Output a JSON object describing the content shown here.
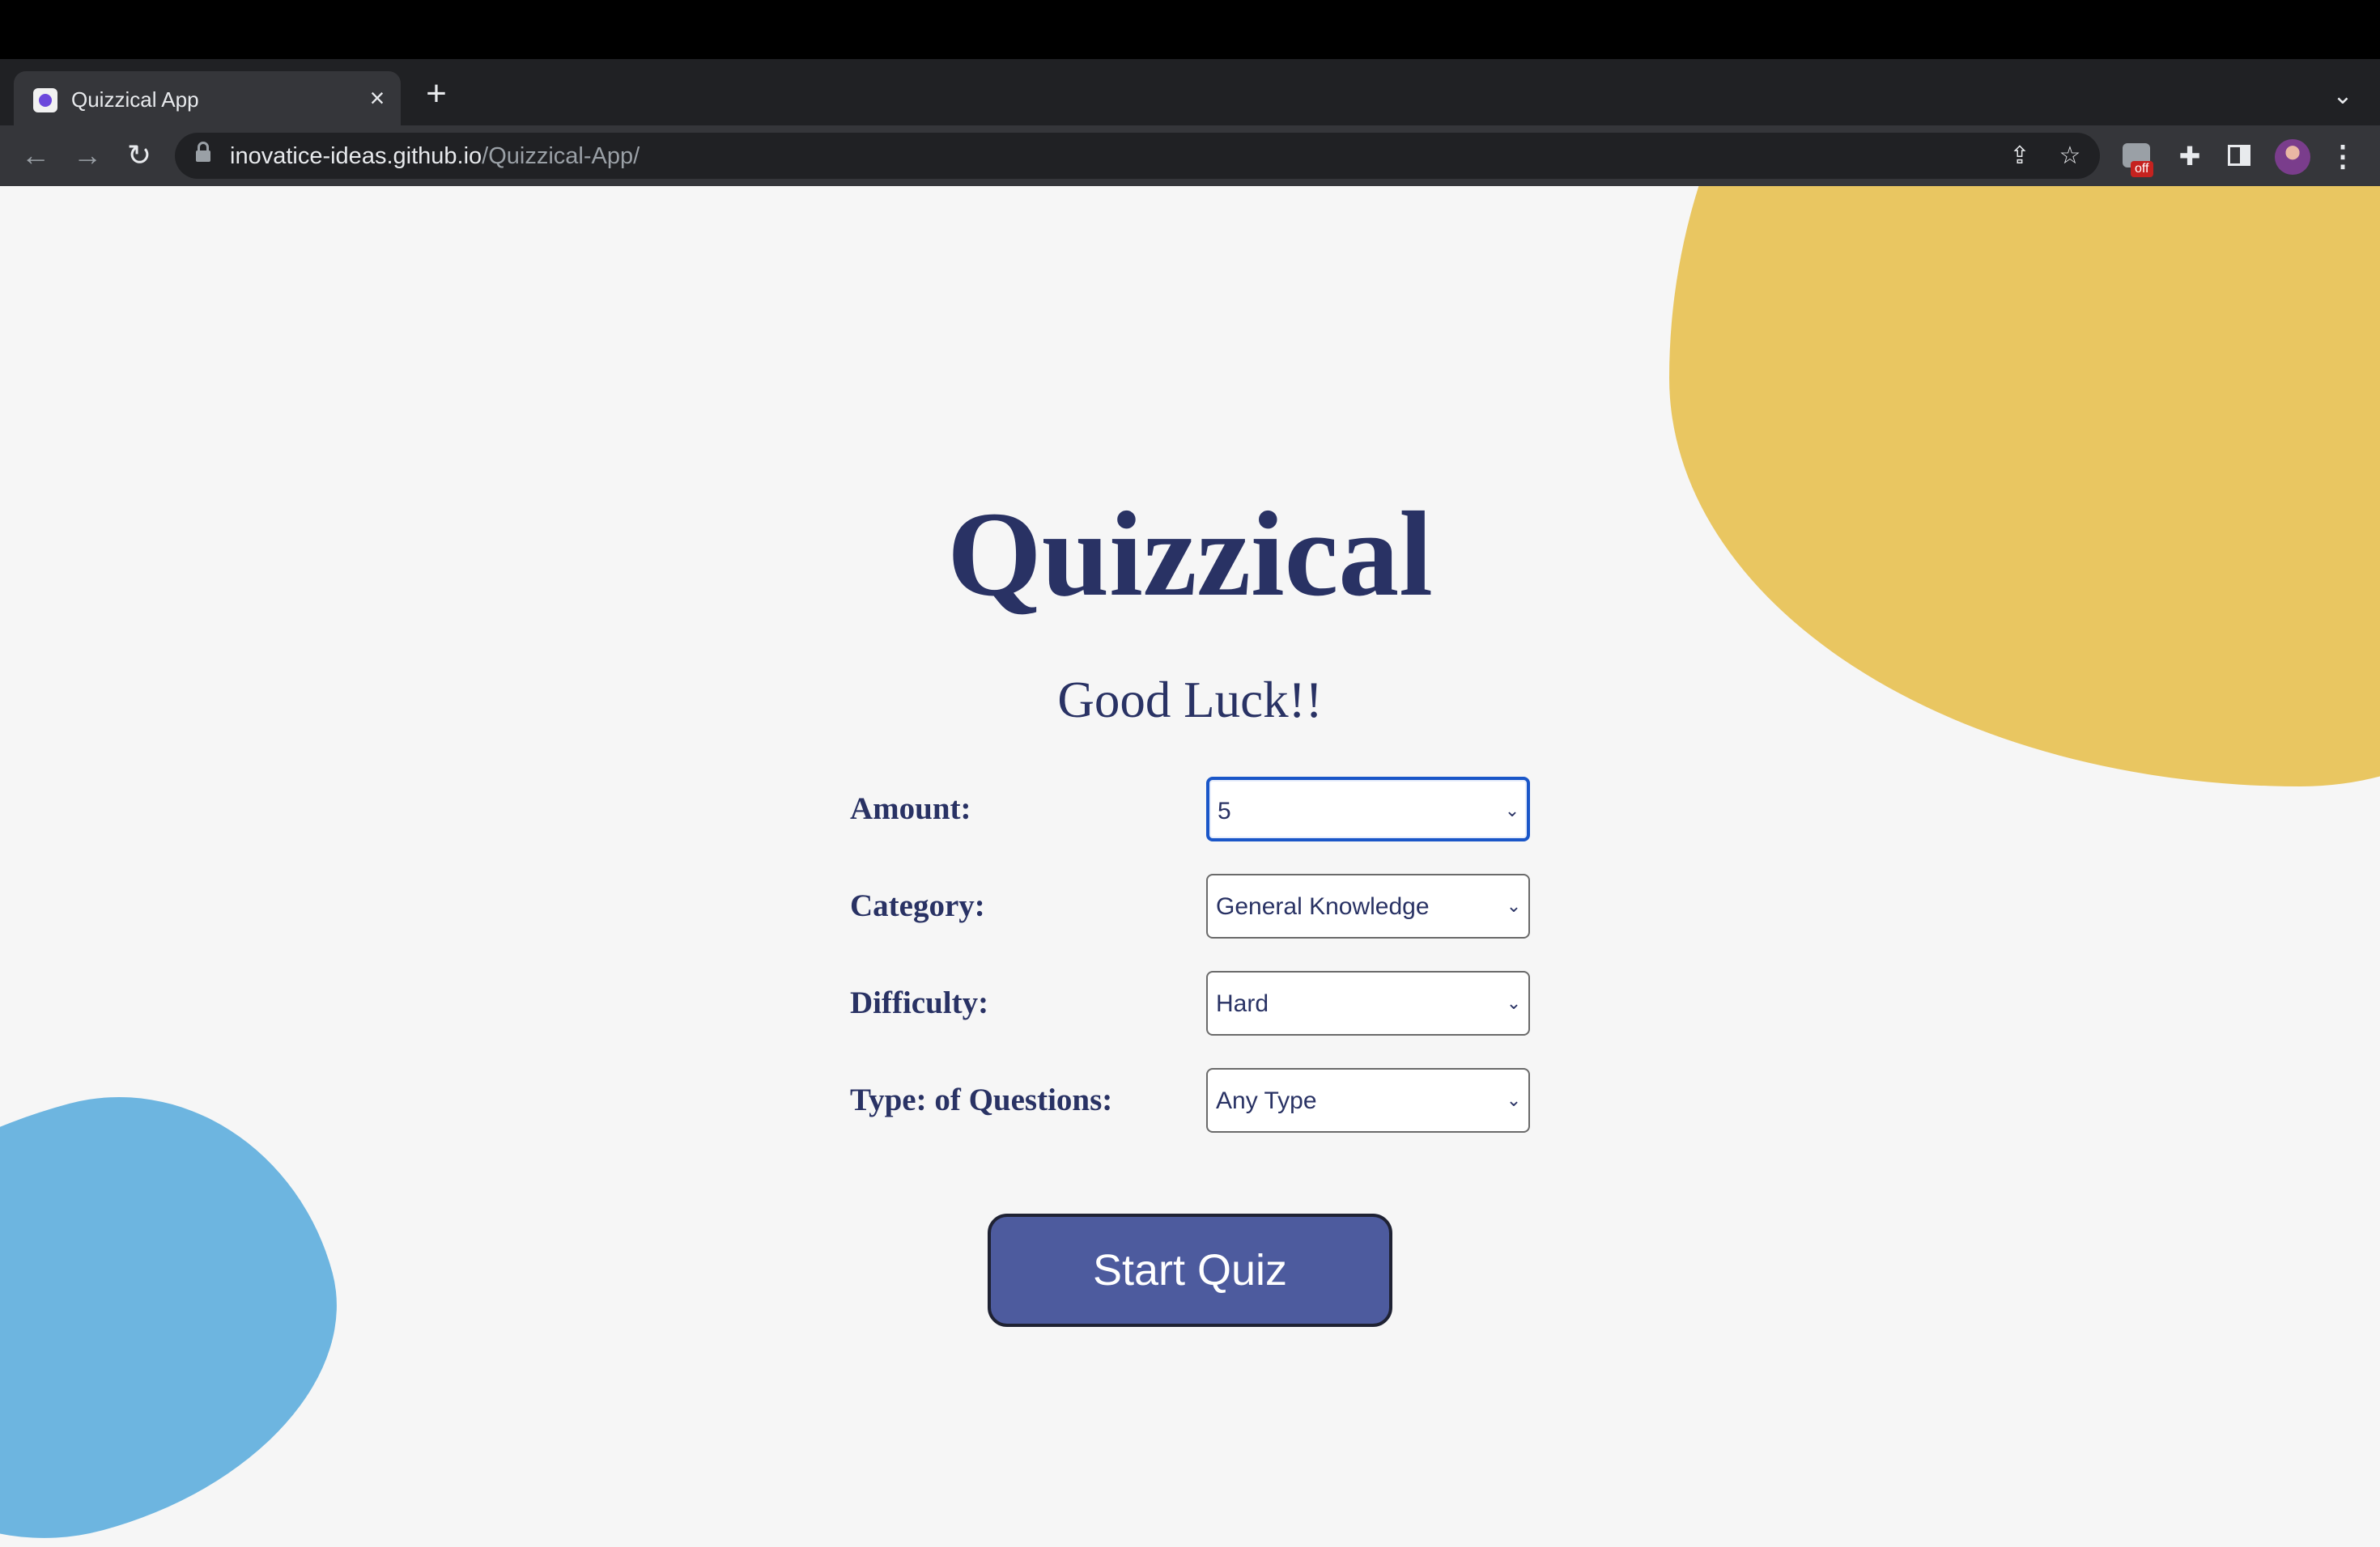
{
  "browser": {
    "tab": {
      "title": "Quizzical App"
    },
    "address": {
      "host": "inovatice-ideas.github.io",
      "path": "/Quizzical-App/"
    },
    "extension_badge": "off"
  },
  "page": {
    "title": "Quizzical",
    "subtitle": "Good Luck!!",
    "form": {
      "amount": {
        "label": "Amount:",
        "value": "5"
      },
      "category": {
        "label": "Category:",
        "value": "General Knowledge"
      },
      "difficulty": {
        "label": "Difficulty:",
        "value": "Hard"
      },
      "type": {
        "label": "Type: of Questions:",
        "value": "Any Type"
      }
    },
    "start_button": "Start Quiz"
  },
  "colors": {
    "accent": "#293264",
    "button": "#4d5b9e",
    "blob_yellow": "#e9c661",
    "blob_blue": "#6db5e0",
    "background": "#f6f6f6"
  }
}
